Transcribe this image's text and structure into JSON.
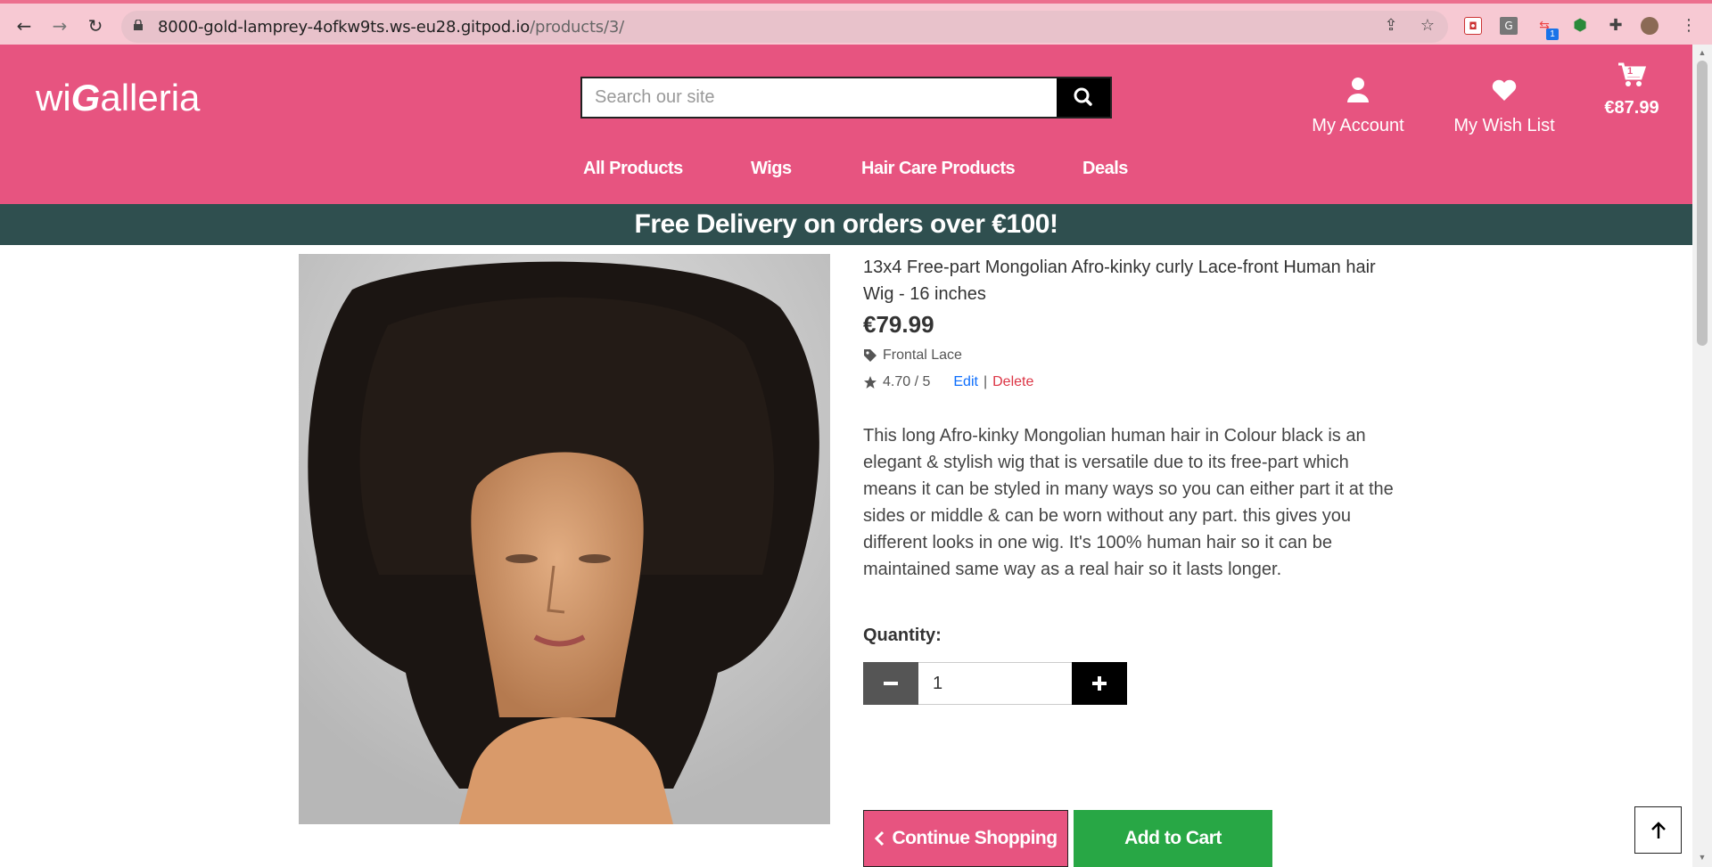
{
  "browser": {
    "url_domain": "8000-gold-lamprey-4ofkw9ts.ws-eu28.gitpod.io",
    "url_path": "/products/3/",
    "extension_badge": "1"
  },
  "header": {
    "logo_part1": "wi",
    "logo_part2": "G",
    "logo_part3": "alleria",
    "search_placeholder": "Search our site",
    "account_label": "My Account",
    "wishlist_label": "My Wish List",
    "cart_total": "€87.99",
    "cart_count": "1"
  },
  "nav": {
    "items": [
      {
        "label": "All Products"
      },
      {
        "label": "Wigs"
      },
      {
        "label": "Hair Care Products"
      },
      {
        "label": "Deals"
      }
    ]
  },
  "banner": {
    "text": "Free Delivery on orders over €100!"
  },
  "product": {
    "title": "13x4 Free-part Mongolian Afro-kinky curly Lace-front Human hair Wig - 16 inches",
    "price": "€79.99",
    "category": "Frontal Lace",
    "rating": "4.70 / 5",
    "edit_label": "Edit",
    "separator": "|",
    "delete_label": "Delete",
    "description": "This long Afro-kinky Mongolian human hair in Colour black is an elegant & stylish wig that is versatile due to its free-part which means it can be styled in many ways so you can either part it at the sides or middle & can be worn without any part. this gives you different looks in one wig. It's 100% human hair so it can be maintained same way as a real hair so it lasts longer.",
    "quantity_label": "Quantity:",
    "quantity_value": "1"
  },
  "actions": {
    "continue_label": "Continue Shopping",
    "add_to_cart_label": "Add to Cart"
  }
}
